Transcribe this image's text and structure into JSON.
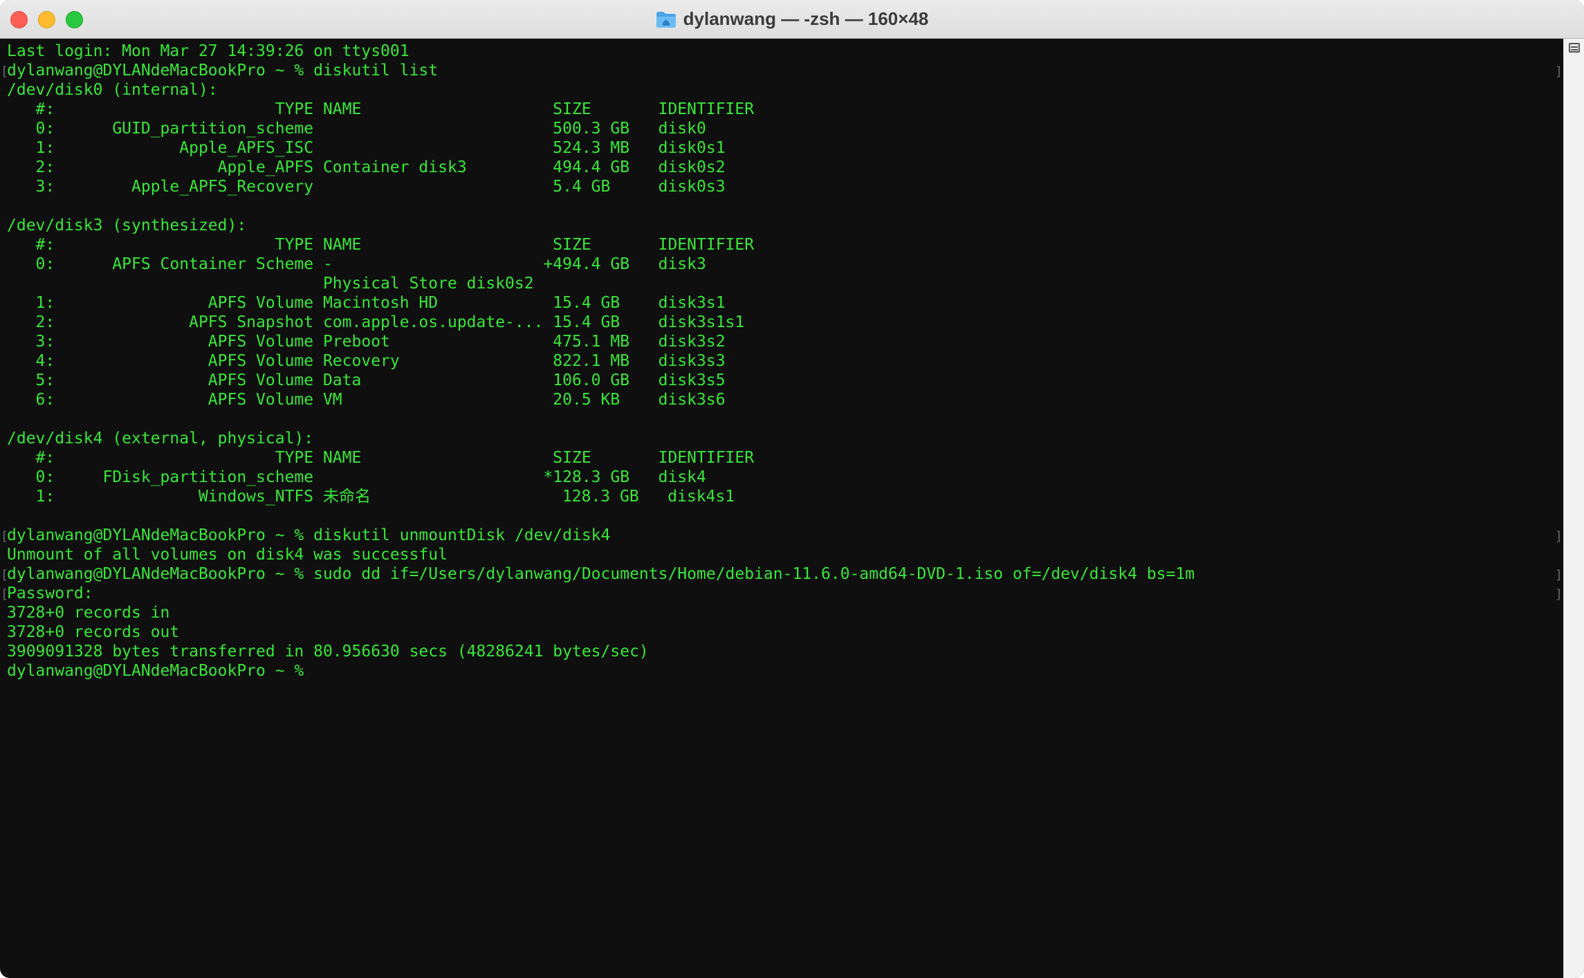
{
  "window": {
    "title": "dylanwang — -zsh — 160×48",
    "icon": "folder-home-icon"
  },
  "colors": {
    "terminal_text": "#39e639",
    "terminal_bg": "#0f0f0f",
    "titlebar_bg": "#e6e6e6"
  },
  "terminal": {
    "lines": [
      {
        "text": "Last login: Mon Mar 27 14:39:26 on ttys001",
        "mark": false
      },
      {
        "text": "dylanwang@DYLANdeMacBookPro ~ % diskutil list",
        "mark": true
      },
      {
        "text": "/dev/disk0 (internal):",
        "mark": false
      },
      {
        "text": "   #:                       TYPE NAME                    SIZE       IDENTIFIER",
        "mark": false
      },
      {
        "text": "   0:      GUID_partition_scheme                         500.3 GB   disk0",
        "mark": false
      },
      {
        "text": "   1:             Apple_APFS_ISC                         524.3 MB   disk0s1",
        "mark": false
      },
      {
        "text": "   2:                 Apple_APFS Container disk3         494.4 GB   disk0s2",
        "mark": false
      },
      {
        "text": "   3:        Apple_APFS_Recovery                         5.4 GB     disk0s3",
        "mark": false
      },
      {
        "text": "",
        "mark": false
      },
      {
        "text": "/dev/disk3 (synthesized):",
        "mark": false
      },
      {
        "text": "   #:                       TYPE NAME                    SIZE       IDENTIFIER",
        "mark": false
      },
      {
        "text": "   0:      APFS Container Scheme -                      +494.4 GB   disk3",
        "mark": false
      },
      {
        "text": "                                 Physical Store disk0s2",
        "mark": false
      },
      {
        "text": "   1:                APFS Volume Macintosh HD            15.4 GB    disk3s1",
        "mark": false
      },
      {
        "text": "   2:              APFS Snapshot com.apple.os.update-... 15.4 GB    disk3s1s1",
        "mark": false
      },
      {
        "text": "   3:                APFS Volume Preboot                 475.1 MB   disk3s2",
        "mark": false
      },
      {
        "text": "   4:                APFS Volume Recovery                822.1 MB   disk3s3",
        "mark": false
      },
      {
        "text": "   5:                APFS Volume Data                    106.0 GB   disk3s5",
        "mark": false
      },
      {
        "text": "   6:                APFS Volume VM                      20.5 KB    disk3s6",
        "mark": false
      },
      {
        "text": "",
        "mark": false
      },
      {
        "text": "/dev/disk4 (external, physical):",
        "mark": false
      },
      {
        "text": "   #:                       TYPE NAME                    SIZE       IDENTIFIER",
        "mark": false
      },
      {
        "text": "   0:     FDisk_partition_scheme                        *128.3 GB   disk4",
        "mark": false
      },
      {
        "text": "   1:               Windows_NTFS 未命名                    128.3 GB   disk4s1",
        "mark": false
      },
      {
        "text": "",
        "mark": false
      },
      {
        "text": "dylanwang@DYLANdeMacBookPro ~ % diskutil unmountDisk /dev/disk4",
        "mark": true
      },
      {
        "text": "Unmount of all volumes on disk4 was successful",
        "mark": false
      },
      {
        "text": "dylanwang@DYLANdeMacBookPro ~ % sudo dd if=/Users/dylanwang/Documents/Home/debian-11.6.0-amd64-DVD-1.iso of=/dev/disk4 bs=1m",
        "mark": true
      },
      {
        "text": "Password:",
        "mark": true
      },
      {
        "text": "3728+0 records in",
        "mark": false
      },
      {
        "text": "3728+0 records out",
        "mark": false
      },
      {
        "text": "3909091328 bytes transferred in 80.956630 secs (48286241 bytes/sec)",
        "mark": false
      },
      {
        "text": "dylanwang@DYLANdeMacBookPro ~ % ",
        "mark": false
      }
    ]
  }
}
